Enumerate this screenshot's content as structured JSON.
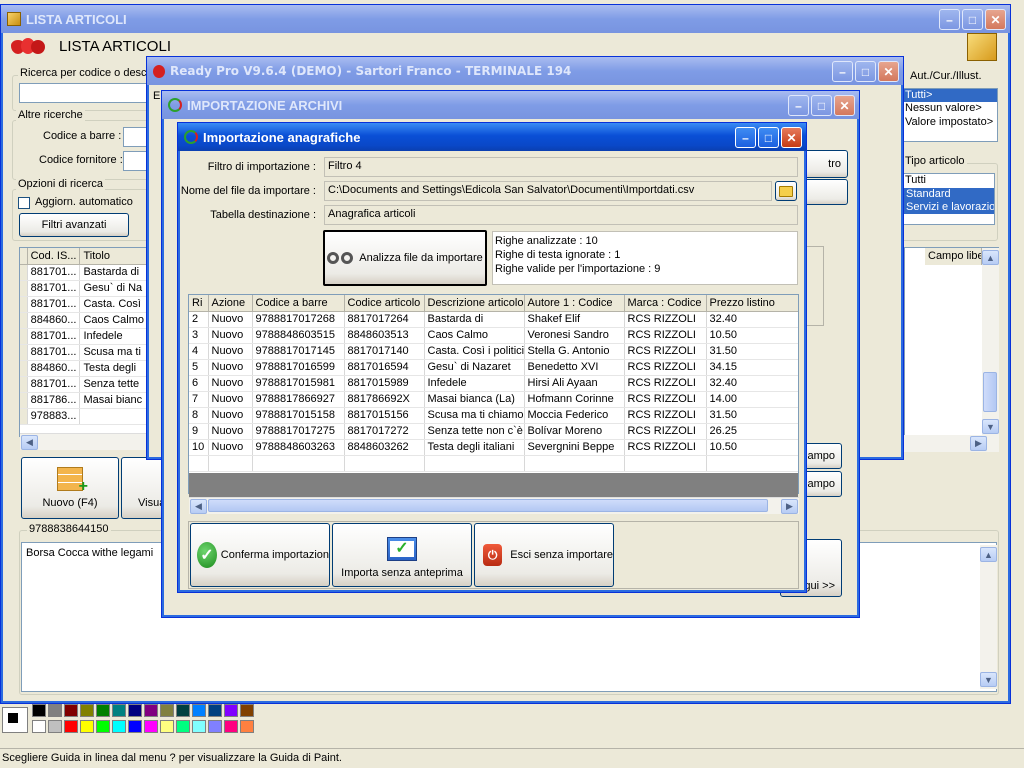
{
  "lista_win": {
    "title": "LISTA ARTICOLI",
    "header": "LISTA ARTICOLI",
    "search_label": "Ricerca per codice o descrizione",
    "other_search": "Altre ricerche",
    "barcode_label": "Codice a barre :",
    "supplier_label": "Codice fornitore :",
    "options_label": "Opzioni di ricerca",
    "auto_update": "Aggiorn. automatico",
    "advanced_filters": "Filtri avanzati",
    "columns": [
      "Cod. IS...",
      "Titolo"
    ],
    "rows": [
      [
        "881701...",
        "Bastarda di"
      ],
      [
        "881701...",
        "Gesu` di Na"
      ],
      [
        "881701...",
        "Casta. Così"
      ],
      [
        "884860...",
        "Caos Calmo"
      ],
      [
        "881701...",
        "Infedele"
      ],
      [
        "881701...",
        "Scusa ma ti"
      ],
      [
        "884860...",
        "Testa degli"
      ],
      [
        "881701...",
        "Senza tette"
      ],
      [
        "881786...",
        "Masai bianc"
      ],
      [
        "978883...",
        ""
      ]
    ],
    "new_button": "Nuovo (F4)",
    "view_button": "Visua",
    "selected_code": "9788838644150",
    "description": "Borsa Cocca withe legami",
    "right_panel": {
      "header": "Aut./Cur./Illust.",
      "aut_items": [
        "Tutti>",
        "Nessun valore>",
        "Valore impostato>"
      ],
      "type_label": "Tipo articolo",
      "type_items": [
        "Tutti",
        "Standard",
        "Servizi e lavorazion"
      ],
      "field_col": "Campo libe"
    }
  },
  "readypro_win": {
    "title": "Ready Pro V9.6.4 (DEMO)  - Sartori Franco - TERMINALE 194",
    "frag": "El",
    "side_btn1": "tro",
    "campo1": "ampo",
    "campo2": "ampo",
    "prosegui": "gui >>"
  },
  "import_win": {
    "title": "IMPORTAZIONE ARCHIVI"
  },
  "anag": {
    "title": "Importazione anagrafiche",
    "filter_label": "Filtro di importazione :",
    "filter_value": "Filtro 4",
    "file_label": "Nome del file da importare :",
    "file_value": "C:\\Documents and Settings\\Edicola San Salvator\\Documenti\\Importdati.csv",
    "table_label": "Tabella destinazione :",
    "table_value": "Anagrafica articoli",
    "analyze_button": "Analizza file da importare",
    "stats": [
      "Righe analizzate : 10",
      "Righe di testa ignorate : 1",
      "Righe valide per l'importazione : 9"
    ],
    "columns": [
      "Ri",
      "Azione",
      "Codice a barre",
      "Codice articolo",
      "Descrizione articolo",
      "Autore 1 : Codice",
      "Marca : Codice",
      "Prezzo listino"
    ],
    "rows": [
      [
        "2",
        "Nuovo",
        "9788817017268",
        "8817017264",
        "Bastarda di",
        "Shakef Elif",
        "RCS RIZZOLI",
        "32.40"
      ],
      [
        "3",
        "Nuovo",
        "9788848603515",
        "8848603513",
        "Caos Calmo",
        "Veronesi Sandro",
        "RCS RIZZOLI",
        "10.50"
      ],
      [
        "4",
        "Nuovo",
        "9788817017145",
        "8817017140",
        "Casta. Così i politici",
        "Stella G. Antonio",
        "RCS RIZZOLI",
        "31.50"
      ],
      [
        "5",
        "Nuovo",
        "9788817016599",
        "8817016594",
        "Gesu` di Nazaret",
        "Benedetto XVI",
        "RCS RIZZOLI",
        "34.15"
      ],
      [
        "6",
        "Nuovo",
        "9788817015981",
        "8817015989",
        "Infedele",
        "Hirsi Ali Ayaan",
        "RCS RIZZOLI",
        "32.40"
      ],
      [
        "7",
        "Nuovo",
        "9788817866927",
        "881786692X",
        "Masai bianca (La)",
        "Hofmann Corinne",
        "RCS RIZZOLI",
        "14.00"
      ],
      [
        "8",
        "Nuovo",
        "9788817015158",
        "8817015156",
        "Scusa ma ti chiamo",
        "Moccia Federico",
        "RCS RIZZOLI",
        "31.50"
      ],
      [
        "9",
        "Nuovo",
        "9788817017275",
        "8817017272",
        "Senza tette non c`è",
        "Bolívar Moreno",
        "RCS RIZZOLI",
        "26.25"
      ],
      [
        "10",
        "Nuovo",
        "9788848603263",
        "8848603262",
        "Testa degli italiani",
        "Severgnini Beppe",
        "RCS RIZZOLI",
        "10.50"
      ]
    ],
    "confirm_button": "Conferma importazion",
    "import_no_preview": "Importa senza anteprima",
    "exit_button": "Esci senza importare"
  },
  "statusbar": "Scegliere Guida in linea dal menu ? per visualizzare la Guida di Paint.",
  "palette": [
    "#000000",
    "#808080",
    "#800000",
    "#808000",
    "#008000",
    "#008080",
    "#000080",
    "#800080",
    "#808040",
    "#004040",
    "#0080ff",
    "#004080",
    "#8000ff",
    "#804000",
    "#ffffff",
    "#c0c0c0",
    "#ff0000",
    "#ffff00",
    "#00ff00",
    "#00ffff",
    "#0000ff",
    "#ff00ff",
    "#ffff80",
    "#00ff80",
    "#80ffff",
    "#8080ff",
    "#ff0080",
    "#ff8040"
  ],
  "colors": {
    "xp_blue": "#0a4fd6",
    "selection": "#316ac5",
    "close_red": "#c53b14"
  }
}
